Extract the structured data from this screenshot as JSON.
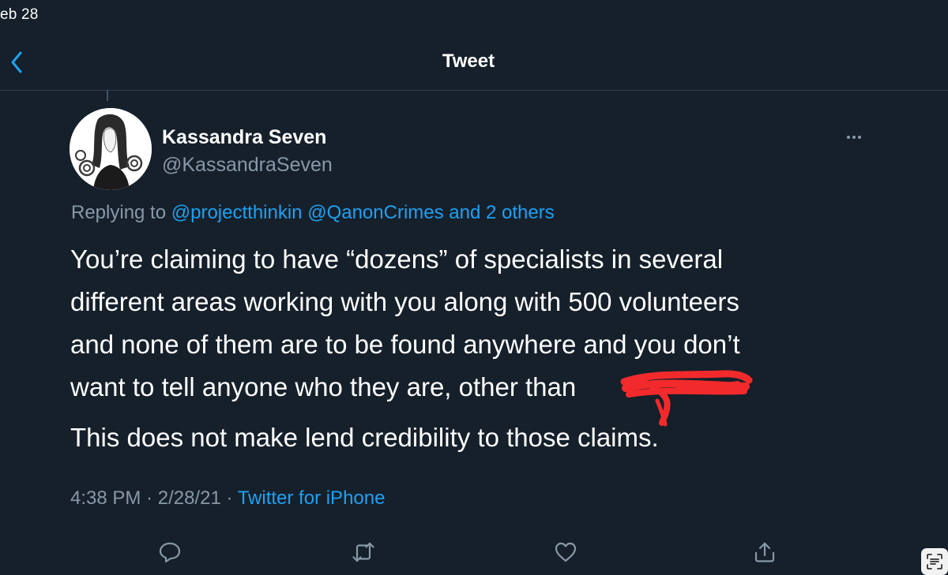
{
  "status_bar": {
    "date_fragment": "eb 28"
  },
  "header": {
    "back_icon": "chevron-left-icon",
    "title": "Tweet"
  },
  "author": {
    "name": "Kassandra Seven",
    "handle": "@KassandraSeven",
    "avatar_icon": "illustrated-woman-avatar"
  },
  "reply_context": {
    "prefix": "Replying to ",
    "mention_1": "@projectthinkin",
    "mention_2": "@QanonCrimes",
    "conjunction": " and ",
    "others": "2 others"
  },
  "tweet": {
    "line_1": "You’re claiming to have “dozens” of specialists in several",
    "line_2": "different areas working with you along with 500 volunteers",
    "line_3": "and none of them are to be found anywhere and you don’t",
    "line_4": "want to tell anyone who they are, other than",
    "paragraph_2": "This does not make lend credibility to those claims."
  },
  "meta": {
    "time": "4:38 PM",
    "separator": " · ",
    "date": "2/28/21",
    "source": "Twitter for iPhone"
  },
  "actions": {
    "reply_icon": "speech-bubble-icon",
    "retweet_icon": "retweet-icon",
    "like_icon": "heart-icon",
    "share_icon": "share-icon"
  },
  "colors": {
    "background": "#15202b",
    "accent": "#1da1f2",
    "muted": "#8899a6",
    "redaction": "#ff3030"
  }
}
